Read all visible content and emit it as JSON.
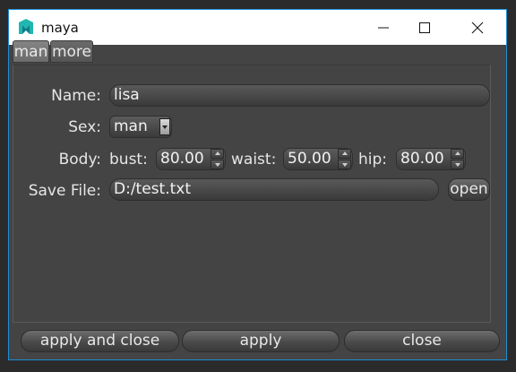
{
  "window": {
    "title": "maya"
  },
  "tabs": [
    {
      "label": "man",
      "active": true
    },
    {
      "label": "more",
      "active": false
    }
  ],
  "form": {
    "name": {
      "label": "Name:",
      "value": "lisa"
    },
    "sex": {
      "label": "Sex:",
      "value": "man"
    },
    "body": {
      "label": "Body:",
      "bust": {
        "label": "bust:",
        "value": "80.00"
      },
      "waist": {
        "label": "waist:",
        "value": "50.00"
      },
      "hip": {
        "label": "hip:",
        "value": "80.00"
      }
    },
    "save_file": {
      "label": "Save File:",
      "value": "D:/test.txt",
      "open_label": "open"
    }
  },
  "footer": {
    "apply_close_label": "apply and close",
    "apply_label": "apply",
    "close_label": "close"
  },
  "colors": {
    "window_border": "#1b8fd6",
    "panel_bg": "#444444",
    "titlebar_bg": "#ffffff",
    "icon_teal": "#1fb7b0"
  }
}
